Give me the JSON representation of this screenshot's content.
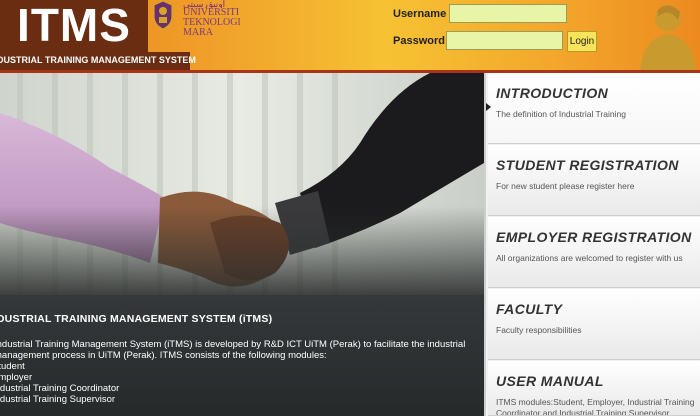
{
  "header": {
    "logo": "ITMS",
    "system_name": "INDUSTRIAL TRAINING MANAGEMENT SYSTEM",
    "university": {
      "jawi": "اونيۏرسيتي",
      "line1": "UNIVERSITI",
      "line2": "TEKNOLOGI",
      "line3": "MARA"
    }
  },
  "login": {
    "username_label": "Username",
    "password_label": "Password",
    "username_value": "",
    "password_value": "",
    "button_label": "Login"
  },
  "info": {
    "title": "INDUSTRIAL TRAINING MANAGEMENT SYSTEM (iTMS)",
    "paragraph_line1": "Industrial Training Management System (iTMS) is developed by R&D ICT UiTM (Perak) to facilitate the industrial",
    "paragraph_line2": "management process in UiTM (Perak). ITMS consists of the following modules:",
    "modules": [
      "Student",
      "Employer",
      "Industrial Training Coordinator",
      "Industrial Training Supervisor"
    ]
  },
  "nav": {
    "items": [
      {
        "title": "INTRODUCTION",
        "description": "The definition of Industrial Training"
      },
      {
        "title": "STUDENT REGISTRATION",
        "description": "For new student please register here"
      },
      {
        "title": "EMPLOYER REGISTRATION",
        "description": "All organizations are welcomed to register with us"
      },
      {
        "title": "FACULTY",
        "description": "Faculty responsibilities"
      },
      {
        "title": "USER MANUAL",
        "description": "ITMS modules:Student, Employer, Industrial Training Coordinator and Industrial Training Supervisor"
      }
    ]
  },
  "colors": {
    "header_brown": "#6a2d12",
    "header_orange": "#f0a02a",
    "input_green": "#e9f5a6",
    "login_yellow": "#f7e45a"
  }
}
